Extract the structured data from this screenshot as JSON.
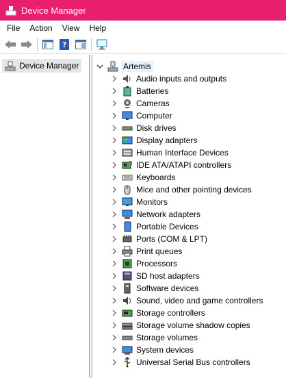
{
  "window": {
    "title": "Device Manager"
  },
  "menu": [
    "File",
    "Action",
    "View",
    "Help"
  ],
  "toolbar": {
    "buttons": [
      "back-arrow-icon",
      "forward-arrow-icon",
      "show-hide-tree-icon",
      "help-icon",
      "properties-pane-icon",
      "scan-hardware-icon"
    ]
  },
  "left_pane": {
    "item": "Device Manager"
  },
  "tree": {
    "root": "Artemis",
    "categories": [
      {
        "label": "Audio inputs and outputs",
        "icon": "speaker-icon"
      },
      {
        "label": "Batteries",
        "icon": "battery-icon"
      },
      {
        "label": "Cameras",
        "icon": "camera-icon"
      },
      {
        "label": "Computer",
        "icon": "computer-icon"
      },
      {
        "label": "Disk drives",
        "icon": "disk-drive-icon"
      },
      {
        "label": "Display adapters",
        "icon": "display-adapter-icon"
      },
      {
        "label": "Human Interface Devices",
        "icon": "hid-icon"
      },
      {
        "label": "IDE ATA/ATAPI controllers",
        "icon": "ide-controller-icon"
      },
      {
        "label": "Keyboards",
        "icon": "keyboard-icon"
      },
      {
        "label": "Mice and other pointing devices",
        "icon": "mouse-icon"
      },
      {
        "label": "Monitors",
        "icon": "monitor-icon"
      },
      {
        "label": "Network adapters",
        "icon": "network-adapter-icon"
      },
      {
        "label": "Portable Devices",
        "icon": "portable-device-icon"
      },
      {
        "label": "Ports (COM & LPT)",
        "icon": "port-icon"
      },
      {
        "label": "Print queues",
        "icon": "printer-icon"
      },
      {
        "label": "Processors",
        "icon": "processor-icon"
      },
      {
        "label": "SD host adapters",
        "icon": "sd-adapter-icon"
      },
      {
        "label": "Software devices",
        "icon": "software-device-icon"
      },
      {
        "label": "Sound, video and game controllers",
        "icon": "sound-controller-icon"
      },
      {
        "label": "Storage controllers",
        "icon": "storage-controller-icon"
      },
      {
        "label": "Storage volume shadow copies",
        "icon": "shadow-copy-icon"
      },
      {
        "label": "Storage volumes",
        "icon": "storage-volume-icon"
      },
      {
        "label": "System devices",
        "icon": "system-device-icon"
      },
      {
        "label": "Universal Serial Bus controllers",
        "icon": "usb-icon"
      }
    ]
  },
  "colors": {
    "titlebar": "#e81e6e",
    "selection": "#e5f3ff"
  }
}
